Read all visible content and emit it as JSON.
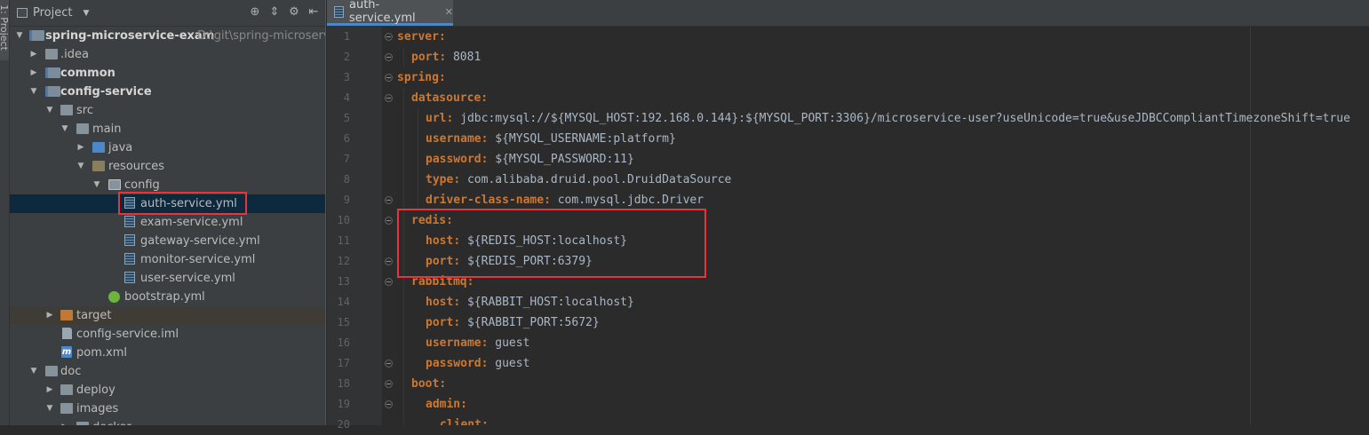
{
  "toolstrip": {
    "tab_label": "1: Project"
  },
  "project_panel": {
    "title": "Project",
    "rows": [
      {
        "label": "spring-microservice-exam",
        "path": "D:\\git\\spring-microservice",
        "bold": true
      },
      {
        "label": ".idea"
      },
      {
        "label": "common",
        "bold": true
      },
      {
        "label": "config-service",
        "bold": true
      },
      {
        "label": "src"
      },
      {
        "label": "main"
      },
      {
        "label": "java"
      },
      {
        "label": "resources"
      },
      {
        "label": "config"
      },
      {
        "label": "auth-service.yml"
      },
      {
        "label": "exam-service.yml"
      },
      {
        "label": "gateway-service.yml"
      },
      {
        "label": "monitor-service.yml"
      },
      {
        "label": "user-service.yml"
      },
      {
        "label": "bootstrap.yml"
      },
      {
        "label": "target"
      },
      {
        "label": "config-service.iml"
      },
      {
        "label": "pom.xml"
      },
      {
        "label": "doc"
      },
      {
        "label": "deploy"
      },
      {
        "label": "images"
      },
      {
        "label": "docker"
      }
    ]
  },
  "editor": {
    "active_tab": "auth-service.yml",
    "line_numbers": [
      "1",
      "2",
      "3",
      "4",
      "5",
      "6",
      "7",
      "8",
      "9",
      "10",
      "11",
      "12",
      "13",
      "14",
      "15",
      "16",
      "17",
      "18",
      "19",
      "20"
    ],
    "lines": [
      {
        "key": "server",
        "value": ""
      },
      {
        "key": "port",
        "value": " 8081"
      },
      {
        "key": "spring",
        "value": ""
      },
      {
        "key": "datasource",
        "value": ""
      },
      {
        "key": "url",
        "value": " jdbc:mysql://${MYSQL_HOST:192.168.0.144}:${MYSQL_PORT:3306}/microservice-user?useUnicode=true&useJDBCCompliantTimezoneShift=true"
      },
      {
        "key": "username",
        "value": " ${MYSQL_USERNAME:platform}"
      },
      {
        "key": "password",
        "value": " ${MYSQL_PASSWORD:11}"
      },
      {
        "key": "type",
        "value": " com.alibaba.druid.pool.DruidDataSource"
      },
      {
        "key": "driver-class-name",
        "value": " com.mysql.jdbc.Driver"
      },
      {
        "key": "redis",
        "value": ""
      },
      {
        "key": "host",
        "value": " ${REDIS_HOST:localhost}"
      },
      {
        "key": "port",
        "value": " ${REDIS_PORT:6379}"
      },
      {
        "key": "rabbitmq",
        "value": ""
      },
      {
        "key": "host",
        "value": " ${RABBIT_HOST:localhost}"
      },
      {
        "key": "port",
        "value": " ${RABBIT_PORT:5672}"
      },
      {
        "key": "username",
        "value": " guest"
      },
      {
        "key": "password",
        "value": " guest"
      },
      {
        "key": "boot",
        "value": ""
      },
      {
        "key": "admin",
        "value": ""
      },
      {
        "key": "client",
        "value": ""
      }
    ]
  },
  "colors": {
    "key": "#cc7832",
    "value": "#a9b7c6",
    "highlight_box": "#e8343b",
    "selection": "#0d293e"
  }
}
